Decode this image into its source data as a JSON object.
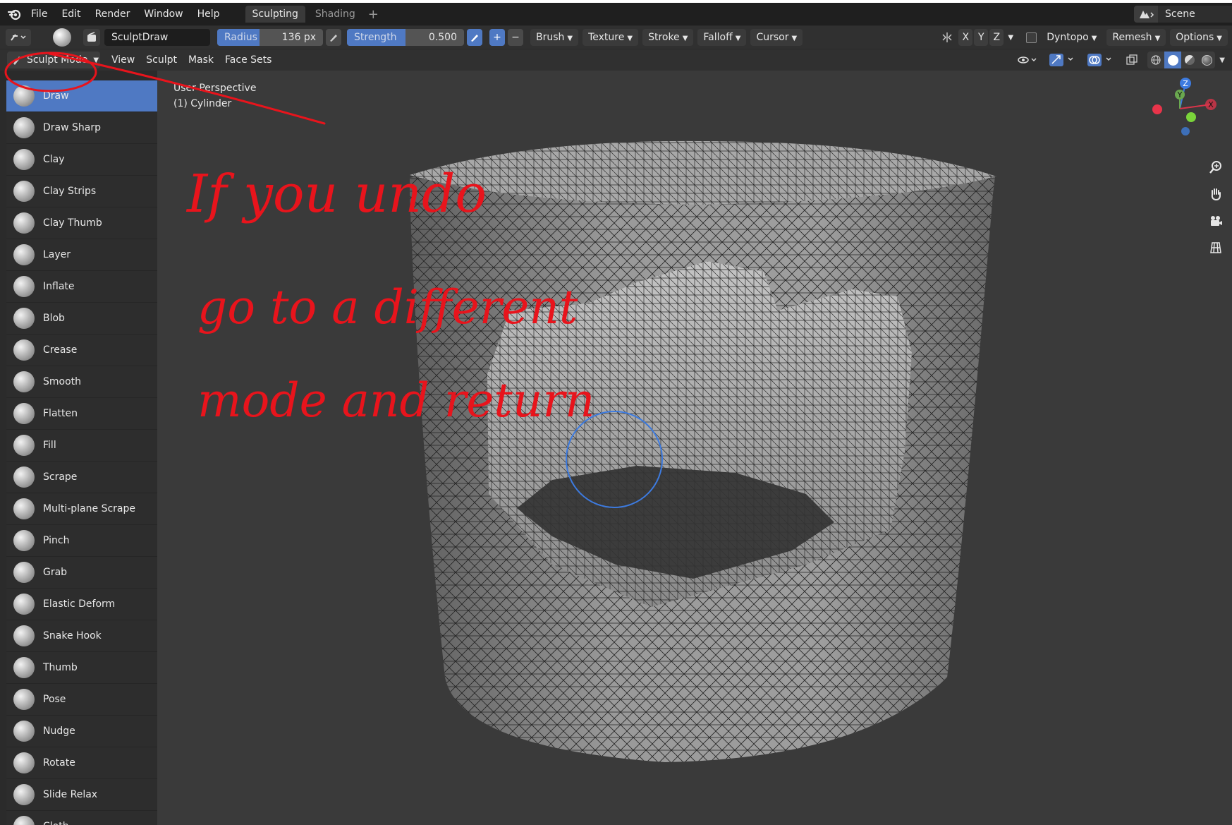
{
  "menubar": {
    "items": [
      "File",
      "Edit",
      "Render",
      "Window",
      "Help"
    ],
    "workspace_tabs": [
      "Sculpting",
      "Shading"
    ],
    "add_tab": "+",
    "scene_name": "Scene"
  },
  "toolheader": {
    "brush_name": "SculptDraw",
    "radius_label": "Radius",
    "radius_value": "136 px",
    "strength_label": "Strength",
    "strength_value": "0.500",
    "strength_fraction": 0.5,
    "plus": "+",
    "minus": "−",
    "menus": [
      "Brush",
      "Texture",
      "Stroke",
      "Falloff",
      "Cursor"
    ],
    "axes": [
      "X",
      "Y",
      "Z"
    ],
    "dyntopo": "Dyntopo",
    "remesh": "Remesh",
    "options": "Options"
  },
  "modeheader": {
    "mode": "Sculpt Mode",
    "items": [
      "View",
      "Sculpt",
      "Mask",
      "Face Sets"
    ]
  },
  "viewport": {
    "perspective": "User Perspective",
    "object": "(1) Cylinder",
    "gizmo": {
      "z": "Z",
      "y": "Y",
      "x": "X"
    }
  },
  "tools": [
    "Draw",
    "Draw Sharp",
    "Clay",
    "Clay Strips",
    "Clay Thumb",
    "Layer",
    "Inflate",
    "Blob",
    "Crease",
    "Smooth",
    "Flatten",
    "Fill",
    "Scrape",
    "Multi-plane Scrape",
    "Pinch",
    "Grab",
    "Elastic Deform",
    "Snake Hook",
    "Thumb",
    "Pose",
    "Nudge",
    "Rotate",
    "Slide Relax",
    "Cloth"
  ],
  "active_tool": "Draw",
  "annotation": {
    "lines": [
      "If you undo",
      "go to a different",
      "mode and return"
    ],
    "color": "#e8141c"
  },
  "colors": {
    "accent": "#4f79c3",
    "menubar_bg": "#1f1f1f",
    "header_bg": "#303030",
    "viewport_bg": "#3a3a3a"
  }
}
